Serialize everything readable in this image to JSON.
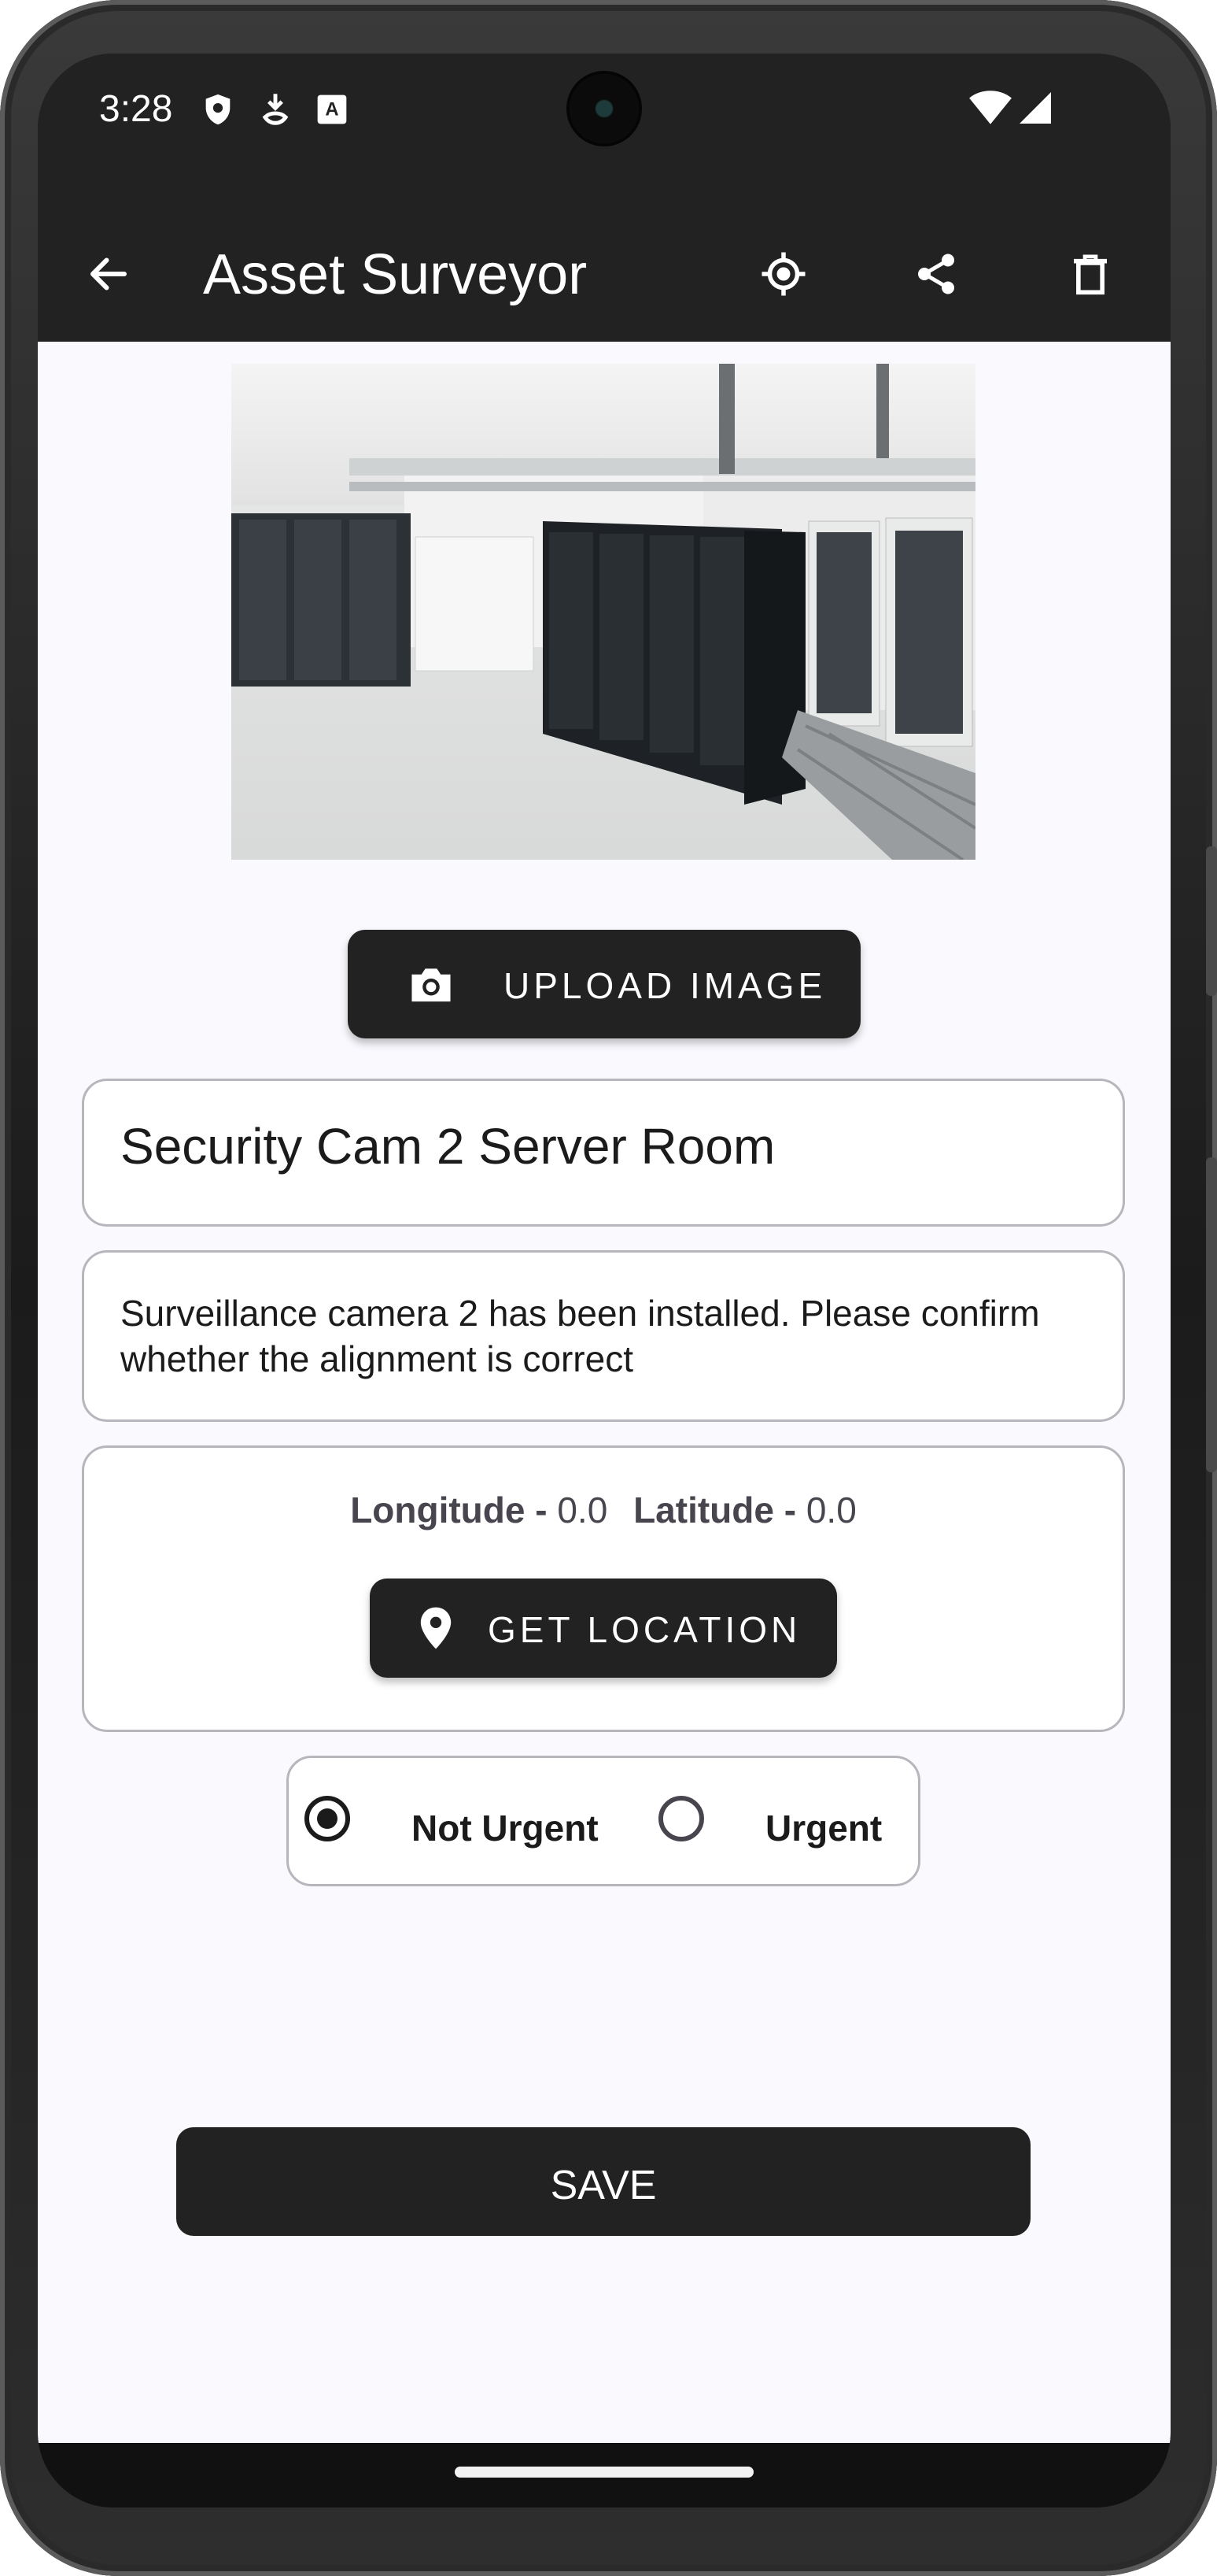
{
  "status_bar": {
    "time": "3:28",
    "icons": [
      "shield-icon",
      "download-icon",
      "font-icon",
      "wifi-icon",
      "signal-icon"
    ]
  },
  "app_bar": {
    "title": "Asset Surveyor",
    "actions": [
      "back-arrow-icon",
      "location-target-icon",
      "share-icon",
      "delete-icon"
    ]
  },
  "asset": {
    "upload_button_label": "UPLOAD IMAGE",
    "title": "Security Cam 2 Server Room",
    "description": "Surveillance camera 2 has been installed. Please confirm whether the alignment is correct",
    "location": {
      "longitude_label": "Longitude -",
      "longitude_value": "0.0",
      "latitude_label": "Latitude -",
      "latitude_value": "0.0",
      "button_label": "GET LOCATION"
    },
    "urgency": {
      "options": [
        "Not Urgent",
        "Urgent"
      ],
      "selected": "Not Urgent"
    }
  },
  "save_button_label": "SAVE",
  "colors": {
    "app_bar": "#222222",
    "background": "#faf9fe",
    "button": "#222222",
    "card_border": "#b8b6bd"
  }
}
